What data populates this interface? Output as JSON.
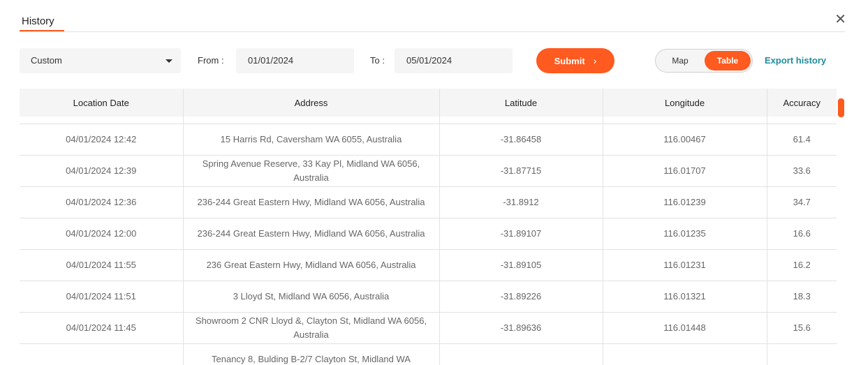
{
  "header": {
    "tab": "History",
    "close": "✕"
  },
  "filters": {
    "preset": "Custom",
    "from_label": "From :",
    "from_value": "01/01/2024",
    "to_label": "To :",
    "to_value": "05/01/2024",
    "submit": "Submit",
    "submit_chevron": "›",
    "view_map": "Map",
    "view_table": "Table",
    "view_selected": "Table",
    "export": "Export history"
  },
  "colors": {
    "accent": "#ff5a1f",
    "link": "#1f8c9d"
  },
  "table": {
    "columns": [
      "Location Date",
      "Address",
      "Latitude",
      "Longitude",
      "Accuracy"
    ],
    "rows": [
      [
        "04/01/2024 12:42",
        "15 Harris Rd, Caversham WA 6055, Australia",
        "-31.86458",
        "116.00467",
        "61.4"
      ],
      [
        "04/01/2024 12:39",
        "Spring Avenue Reserve, 33 Kay Pl, Midland WA 6056, Australia",
        "-31.87715",
        "116.01707",
        "33.6"
      ],
      [
        "04/01/2024 12:36",
        "236-244 Great Eastern Hwy, Midland WA 6056, Australia",
        "-31.8912",
        "116.01239",
        "34.7"
      ],
      [
        "04/01/2024 12:00",
        "236-244 Great Eastern Hwy, Midland WA 6056, Australia",
        "-31.89107",
        "116.01235",
        "16.6"
      ],
      [
        "04/01/2024 11:55",
        "236 Great Eastern Hwy, Midland WA 6056, Australia",
        "-31.89105",
        "116.01231",
        "16.2"
      ],
      [
        "04/01/2024 11:51",
        "3 Lloyd St, Midland WA 6056, Australia",
        "-31.89226",
        "116.01321",
        "18.3"
      ],
      [
        "04/01/2024 11:45",
        "Showroom 2 CNR Lloyd &, Clayton St, Midland WA 6056, Australia",
        "-31.89636",
        "116.01448",
        "15.6"
      ],
      [
        "",
        "Tenancy 8, Bulding B-2/7 Clayton St, Midland WA",
        "",
        "",
        ""
      ]
    ]
  }
}
